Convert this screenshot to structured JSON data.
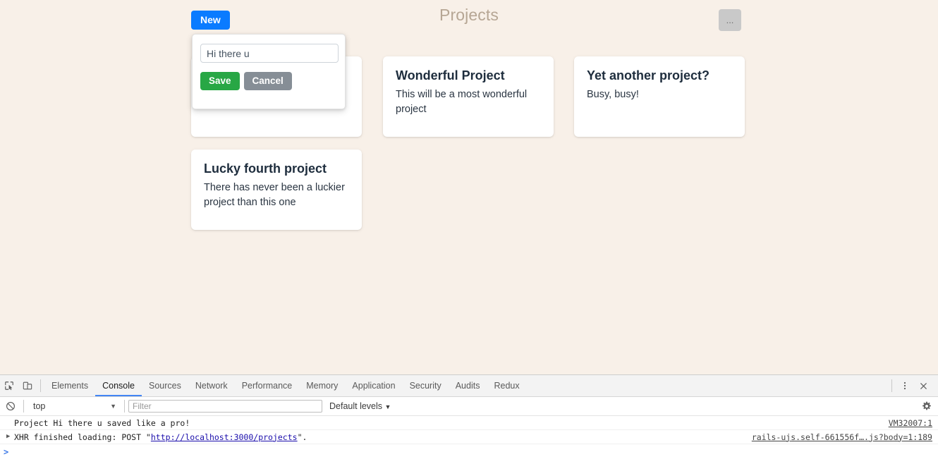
{
  "app": {
    "title": "Projects",
    "new_button_label": "New",
    "more_button_label": "...",
    "accent_blue": "#0a7bff",
    "background": "#f8f0e8",
    "title_color": "#b6a694"
  },
  "new_project_form": {
    "input_value": "Hi there u",
    "input_placeholder": "",
    "save_label": "Save",
    "cancel_label": "Cancel",
    "save_color": "#28a745",
    "cancel_color": "#868e96"
  },
  "projects": [
    {
      "title": "",
      "description": ""
    },
    {
      "title": "Wonderful Project",
      "description": "This will be a most wonderful project"
    },
    {
      "title": "Yet another project?",
      "description": "Busy, busy!"
    },
    {
      "title": "Lucky fourth project",
      "description": "There has never been a luckier project than this one"
    }
  ],
  "devtools": {
    "tabs": [
      {
        "label": "Elements",
        "active": false
      },
      {
        "label": "Console",
        "active": true
      },
      {
        "label": "Sources",
        "active": false
      },
      {
        "label": "Network",
        "active": false
      },
      {
        "label": "Performance",
        "active": false
      },
      {
        "label": "Memory",
        "active": false
      },
      {
        "label": "Application",
        "active": false
      },
      {
        "label": "Security",
        "active": false
      },
      {
        "label": "Audits",
        "active": false
      },
      {
        "label": "Redux",
        "active": false
      }
    ],
    "active_tab_underline": "#4285f4",
    "filterbar": {
      "context_value": "top",
      "filter_placeholder": "Filter",
      "filter_value": "",
      "levels_label": "Default levels"
    },
    "console_messages": [
      {
        "text": "Project Hi there u saved like a pro!",
        "source": "VM32007:1",
        "expandable": false
      },
      {
        "text_before_link": "XHR finished loading: POST \"",
        "link": "http://localhost:3000/projects",
        "text_after_link": "\".",
        "source": "rails-ujs.self-661556f….js?body=1:189",
        "expandable": true
      }
    ],
    "prompt": ">"
  }
}
